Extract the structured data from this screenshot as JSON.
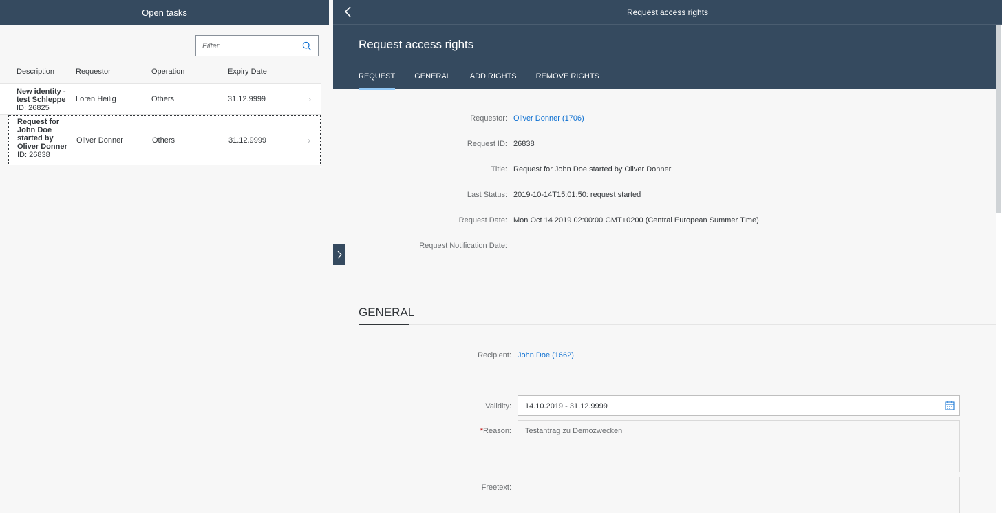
{
  "left": {
    "header_title": "Open tasks",
    "filter": {
      "placeholder": "Filter",
      "icon": "search-icon"
    },
    "columns": [
      "Description",
      "Requestor",
      "Operation",
      "Expiry Date"
    ],
    "rows": [
      {
        "title_lines": [
          "New identity -",
          "test Schleppe"
        ],
        "id_text": "ID: 26825",
        "requestor": "Loren Heilig",
        "operation": "Others",
        "expiry": "31.12.9999"
      },
      {
        "title_lines": [
          "Request for",
          "John Doe",
          "started by",
          "Oliver Donner"
        ],
        "id_text": "ID: 26838",
        "requestor": "Oliver Donner",
        "operation": "Others",
        "expiry": "31.12.9999"
      }
    ]
  },
  "right": {
    "topbar_title": "Request access rights",
    "object_title": "Request access rights",
    "tabs": [
      "REQUEST",
      "GENERAL",
      "ADD RIGHTS",
      "REMOVE RIGHTS"
    ],
    "request_fields": {
      "requestor_label": "Requestor:",
      "requestor_value": "Oliver Donner (1706)",
      "request_id_label": "Request ID:",
      "request_id_value": "26838",
      "title_label": "Title:",
      "title_value": "Request for John Doe started by Oliver Donner",
      "last_status_label": "Last Status:",
      "last_status_value": "2019-10-14T15:01:50: request started",
      "request_date_label": "Request Date:",
      "request_date_value": "Mon Oct 14 2019 02:00:00 GMT+0200 (Central European Summer Time)",
      "notification_label": "Request Notification Date:"
    },
    "general": {
      "section_title": "GENERAL",
      "recipient_label": "Recipient:",
      "recipient_value": "John Doe (1662)",
      "validity_label": "Validity:",
      "validity_value": "14.10.2019 - 31.12.9999",
      "reason_star": "*",
      "reason_label": "Reason:",
      "reason_value": "Testantrag zu Demozwecken",
      "freetext_label": "Freetext:"
    }
  },
  "colors": {
    "shell": "#354a5f",
    "link": "#0a6ed1",
    "tab_highlight": "#91c8f6",
    "required": "#bb0000"
  }
}
